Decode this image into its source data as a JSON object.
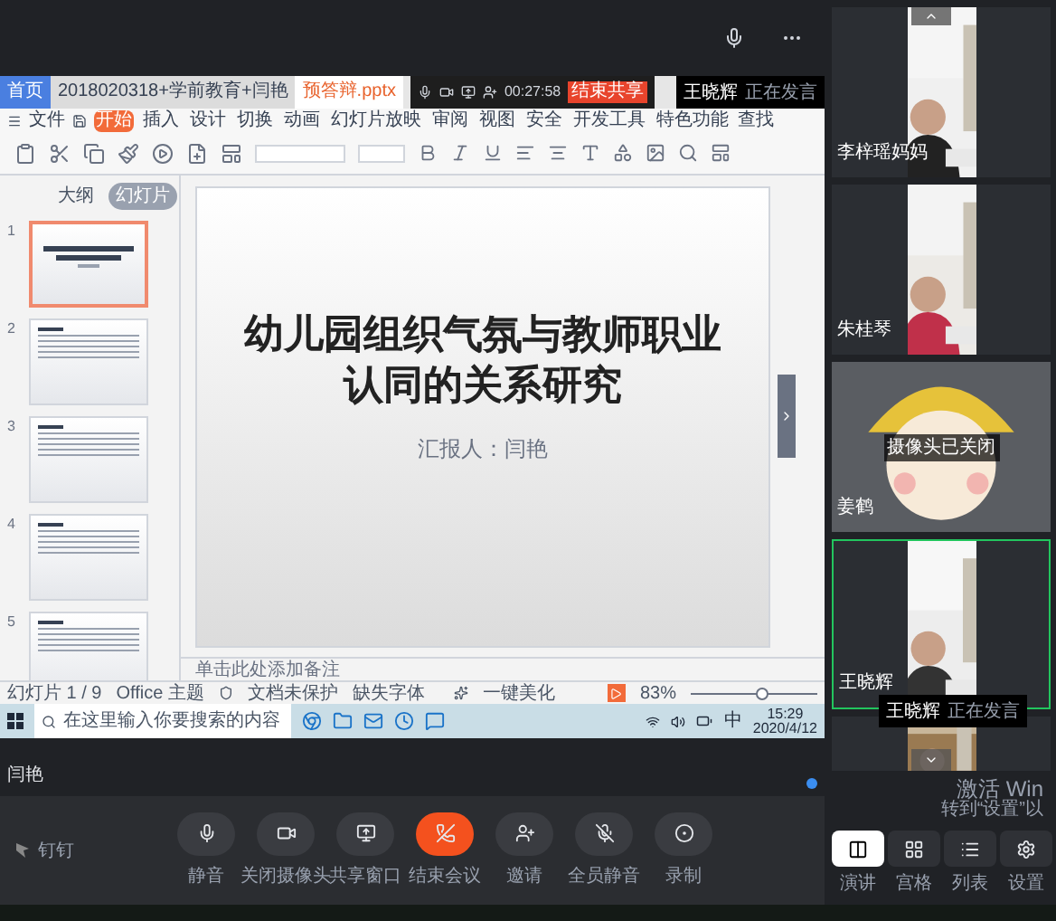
{
  "shared_screen": {
    "doc_tabs": [
      {
        "label": "首页",
        "kind": "home",
        "selected": false
      },
      {
        "label": "2018020318+学前教育+闫艳",
        "kind": "doc",
        "selected": false
      },
      {
        "label": "预答辩.pptx",
        "kind": "doc",
        "selected": true
      }
    ],
    "share_toolbar": {
      "timer": "00:27:58",
      "stop_button": "结束共享"
    },
    "speaker_banner": {
      "name": "王晓辉",
      "status": "正在发言"
    },
    "menu": {
      "file": "文件",
      "tabs": [
        {
          "label": "开始",
          "selected": true
        },
        {
          "label": "插入",
          "selected": false
        },
        {
          "label": "设计",
          "selected": false
        },
        {
          "label": "切换",
          "selected": false
        },
        {
          "label": "动画",
          "selected": false
        },
        {
          "label": "幻灯片放映",
          "selected": false
        },
        {
          "label": "审阅",
          "selected": false
        },
        {
          "label": "视图",
          "selected": false
        },
        {
          "label": "安全",
          "selected": false
        },
        {
          "label": "开发工具",
          "selected": false
        },
        {
          "label": "特色功能",
          "selected": false
        }
      ],
      "search": "查找"
    },
    "panel_tabs": [
      {
        "label": "大纲",
        "selected": false
      },
      {
        "label": "幻灯片",
        "selected": true
      }
    ],
    "slides": [
      {
        "number": "1",
        "selected": true
      },
      {
        "number": "2",
        "selected": false
      },
      {
        "number": "3",
        "selected": false
      },
      {
        "number": "4",
        "selected": false
      },
      {
        "number": "5",
        "selected": false
      }
    ],
    "slide": {
      "title": "幼儿园组织气氛与教师职业认同的关系研究",
      "presenter": "汇报人：闫艳"
    },
    "notes_placeholder": "单击此处添加备注",
    "status_bar": {
      "slide_count": "幻灯片 1 / 9",
      "theme": "Office 主题",
      "protection": "文档未保护",
      "fonts": "缺失字体",
      "beautify": "一键美化",
      "zoom": "83%",
      "zoom_slider": {
        "level": 0.55
      }
    },
    "taskbar": {
      "search_placeholder": "在这里输入你要搜索的内容",
      "ime": "中",
      "time": "15:29",
      "date": "2020/4/12"
    }
  },
  "presenter_name": "闫艳",
  "controls": {
    "app_name": "钉钉",
    "buttons": [
      {
        "label": "静音",
        "kind": "mic"
      },
      {
        "label": "关闭摄像头",
        "kind": "camera"
      },
      {
        "label": "共享窗口",
        "kind": "share"
      },
      {
        "label": "结束会议",
        "kind": "end"
      },
      {
        "label": "邀请",
        "kind": "invite"
      },
      {
        "label": "全员静音",
        "kind": "mute_all"
      },
      {
        "label": "录制",
        "kind": "record"
      }
    ]
  },
  "participants": [
    {
      "name": "李梓瑶妈妈",
      "kind": "video",
      "speaking": false
    },
    {
      "name": "朱桂琴",
      "kind": "video",
      "speaking": false
    },
    {
      "name": "姜鹤",
      "kind": "camera_off",
      "overlay": "摄像头已关闭",
      "speaking": false
    },
    {
      "name": "王晓辉",
      "kind": "video",
      "speaking": true
    },
    {
      "kind": "video",
      "speaking": false
    }
  ],
  "speaking_tooltip": {
    "name": "王晓辉",
    "status": "正在发言"
  },
  "layout_buttons": [
    {
      "label": "演讲",
      "kind": "speaker",
      "selected": true
    },
    {
      "label": "宫格",
      "kind": "grid",
      "selected": false
    },
    {
      "label": "列表",
      "kind": "list",
      "selected": false
    },
    {
      "label": "设置",
      "kind": "settings",
      "selected": false
    }
  ],
  "activation_watermark": [
    "激活 Win",
    "转到“设置”以"
  ]
}
